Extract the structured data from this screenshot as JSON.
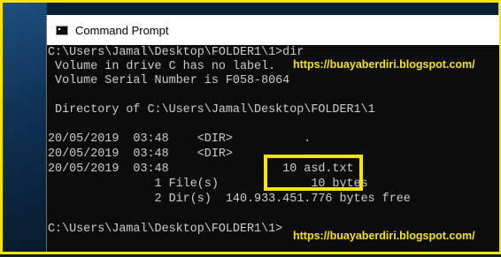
{
  "window": {
    "title": "Command Prompt",
    "icon": "cmd-icon"
  },
  "console": {
    "lines": [
      "C:\\Users\\Jamal\\Desktop\\FOLDER1\\1>dir",
      " Volume in drive C has no label.",
      " Volume Serial Number is F058-8064",
      "",
      " Directory of C:\\Users\\Jamal\\Desktop\\FOLDER1\\1",
      "",
      "20/05/2019  03:48    <DIR>          .",
      "20/05/2019  03:48    <DIR>          ..",
      "20/05/2019  03:48                10 asd.txt",
      "               1 File(s)             10 bytes",
      "               2 Dir(s)  140.933.451.776 bytes free",
      "",
      "C:\\Users\\Jamal\\Desktop\\FOLDER1\\1>"
    ]
  },
  "watermark": {
    "top": "https://buayaberdiri.blogspot.com/",
    "bottom": "https://buayaberdiri.blogspot.com/"
  },
  "colors": {
    "accent": "#f5e409",
    "console_bg": "#0c0c0c",
    "console_text": "#cccccc"
  }
}
